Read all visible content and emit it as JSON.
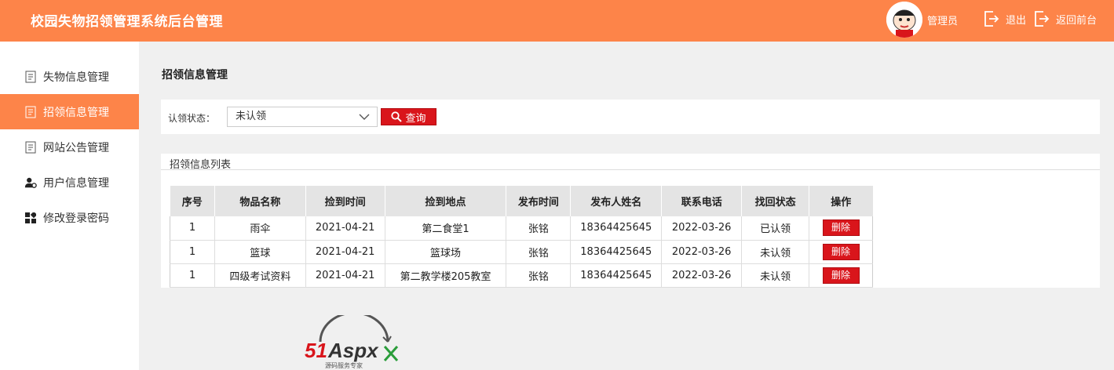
{
  "header": {
    "title": "校园失物招领管理系统后台管理",
    "user_label": "管理员",
    "logout_label": "退出",
    "back_label": "返回前台",
    "accent_color": "#fd8449"
  },
  "sidebar": {
    "items": [
      {
        "label": "失物信息管理",
        "icon": "document-icon",
        "active": false
      },
      {
        "label": "招领信息管理",
        "icon": "document-icon",
        "active": true
      },
      {
        "label": "网站公告管理",
        "icon": "document-icon",
        "active": false
      },
      {
        "label": "用户信息管理",
        "icon": "user-settings-icon",
        "active": false
      },
      {
        "label": "修改登录密码",
        "icon": "grid-icon",
        "active": false
      }
    ]
  },
  "main": {
    "page_title": "招领信息管理",
    "filter": {
      "label": "认领状态：",
      "selected": "未认领",
      "query_label": "查询"
    },
    "list": {
      "title": "招领信息列表",
      "columns": [
        "序号",
        "物品名称",
        "捡到时间",
        "捡到地点",
        "发布时间",
        "发布人姓名",
        "联系电话",
        "找回状态",
        "操作"
      ],
      "rows": [
        {
          "no": "1",
          "name": "雨伞",
          "found_time": "2021-04-21",
          "place": "第二食堂1",
          "pub_time": "张铭",
          "publisher": "18364425645",
          "phone": "2022-03-26",
          "status": "已认领",
          "action": "删除"
        },
        {
          "no": "1",
          "name": "篮球",
          "found_time": "2021-04-21",
          "place": "篮球场",
          "pub_time": "张铭",
          "publisher": "18364425645",
          "phone": "2022-03-26",
          "status": "未认领",
          "action": "删除"
        },
        {
          "no": "1",
          "name": "四级考试资料",
          "found_time": "2021-04-21",
          "place": "第二教学楼205教室",
          "pub_time": "张铭",
          "publisher": "18364425645",
          "phone": "2022-03-26",
          "status": "未认领",
          "action": "删除"
        }
      ]
    }
  },
  "watermark": {
    "brand": "51Aspx",
    "tagline": "源码服务专家"
  }
}
